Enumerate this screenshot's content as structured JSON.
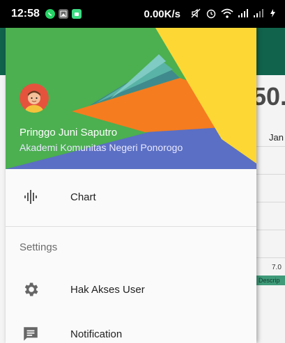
{
  "status_bar": {
    "time": "12:58",
    "network_speed": "0.00K/s",
    "icons": [
      "whatsapp-icon",
      "gallery-icon",
      "android-icon",
      "mute-icon",
      "alarm-icon",
      "wifi-icon",
      "signal-icon",
      "signal-icon",
      "charging-icon"
    ]
  },
  "drawer": {
    "header": {
      "user_name": "Pringgo Juni Saputro",
      "user_org": "Akademi Komunitas Negeri Ponorogo"
    },
    "menu": [
      {
        "icon": "chart-icon",
        "label": "Chart"
      }
    ],
    "settings_section": {
      "title": "Settings",
      "items": [
        {
          "icon": "gear-icon",
          "label": "Hak Akses User"
        },
        {
          "icon": "notification-icon",
          "label": "Notification"
        }
      ]
    }
  },
  "background_app": {
    "big_value": "50.",
    "column_header": "Jan",
    "tick_value": "7.0",
    "description_label": "Descrip"
  },
  "colors": {
    "header_green": "#4caf50",
    "header_yellow": "#fdd835",
    "header_orange": "#f57c1f",
    "header_blue": "#5b6fc4",
    "app_bar": "#11634c"
  }
}
